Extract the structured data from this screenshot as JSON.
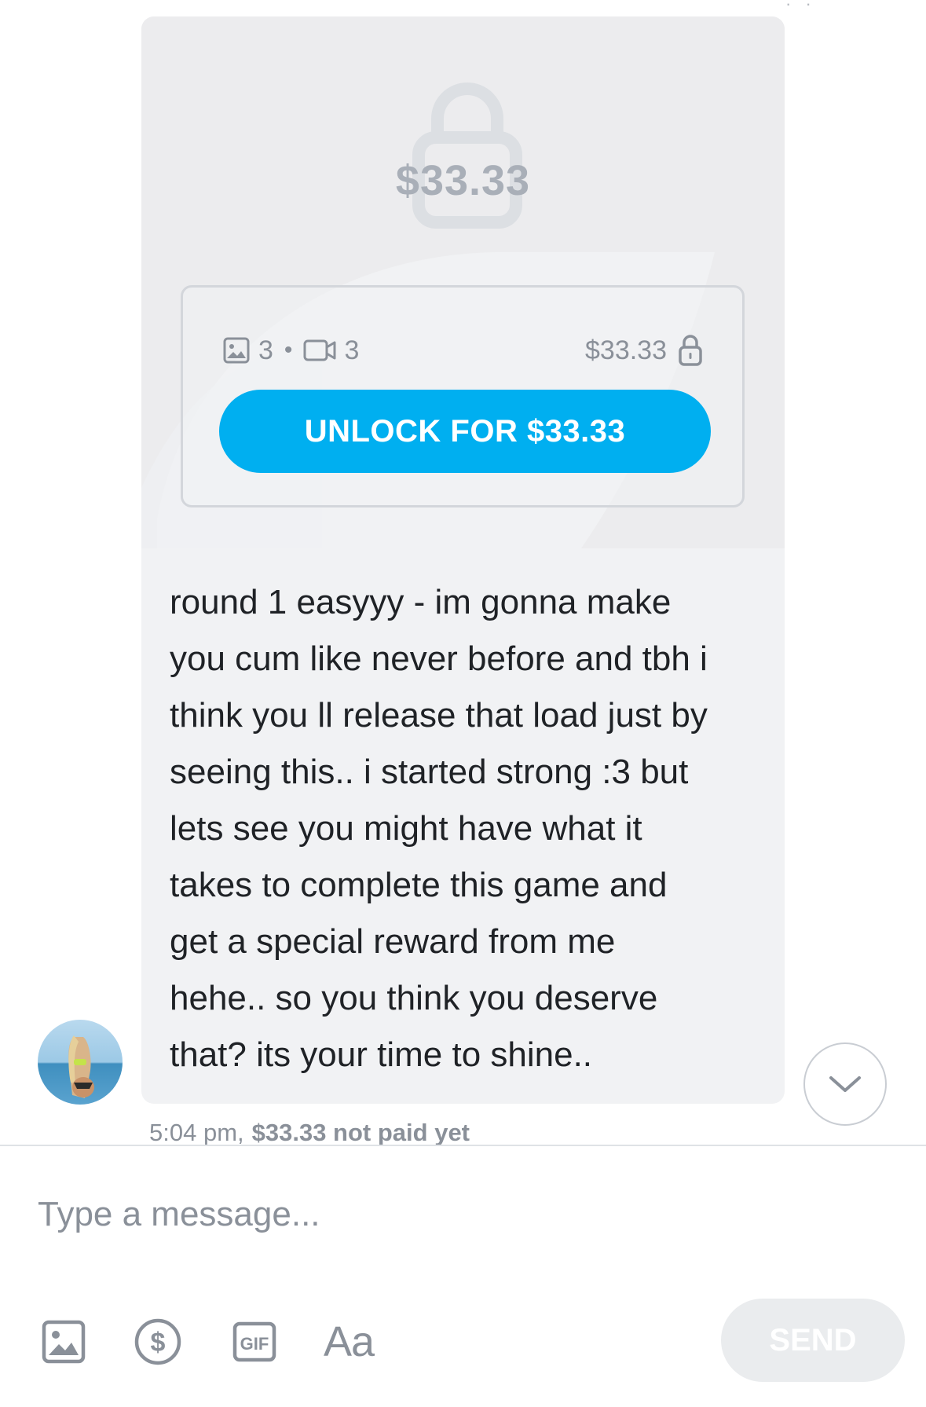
{
  "message": {
    "locked_price": "$33.33",
    "media": {
      "photos": "3",
      "separator": "•",
      "videos": "3"
    },
    "card_price": "$33.33",
    "unlock_label": "UNLOCK FOR $33.33",
    "text_lines": [
      "round 1 easyyy - im gonna make",
      "you cum like never before and tbh i",
      "think you ll release that load just by",
      "seeing this.. i started strong :3 but",
      "lets see you might have what it",
      "takes to complete this game and",
      "get a special reward from me",
      "hehe.. so you think you deserve",
      "that? its your time to shine.."
    ],
    "time": "5:04 pm,",
    "payment_status": "$33.33 not paid yet"
  },
  "composer": {
    "placeholder": "Type a message...",
    "text_format_label": "Aa",
    "send_label": "SEND"
  },
  "icons": {
    "lock": "lock-icon",
    "photo": "image-icon",
    "video": "video-icon",
    "tip": "dollar-icon",
    "gif": "gif-icon",
    "scroll": "chevron-down-icon"
  },
  "colors": {
    "accent": "#00aff0",
    "bubble": "#f1f2f4",
    "muted": "#8a9099",
    "send_disabled": "#eaecee"
  }
}
